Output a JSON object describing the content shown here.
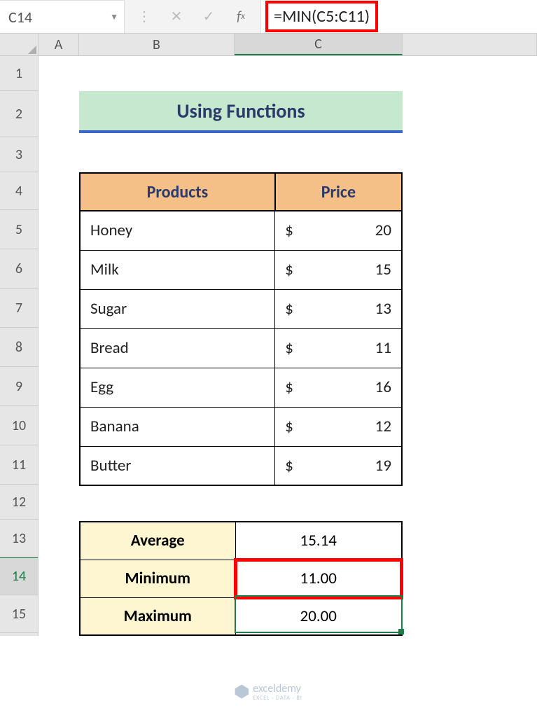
{
  "formulaBar": {
    "nameBox": "C14",
    "formula": "=MIN(C5:C11)"
  },
  "columns": [
    "A",
    "B",
    "C"
  ],
  "rowNumbers": [
    "1",
    "2",
    "3",
    "4",
    "5",
    "6",
    "7",
    "8",
    "9",
    "10",
    "11",
    "12",
    "13",
    "14",
    "15"
  ],
  "sheet": {
    "title": "Using Functions",
    "table": {
      "headers": {
        "col1": "Products",
        "col2": "Price"
      },
      "currency": "$",
      "rows": [
        {
          "product": "Honey",
          "price": "20"
        },
        {
          "product": "Milk",
          "price": "15"
        },
        {
          "product": "Sugar",
          "price": "13"
        },
        {
          "product": "Bread",
          "price": "11"
        },
        {
          "product": "Egg",
          "price": "16"
        },
        {
          "product": "Banana",
          "price": "12"
        },
        {
          "product": "Butter",
          "price": "19"
        }
      ]
    },
    "summary": {
      "averageLabel": "Average",
      "averageValue": "15.14",
      "minLabel": "Minimum",
      "minValue": "11.00",
      "maxLabel": "Maximum",
      "maxValue": "20.00"
    }
  },
  "watermark": {
    "name": "exceldemy",
    "sub": "EXCEL · DATA · BI"
  }
}
